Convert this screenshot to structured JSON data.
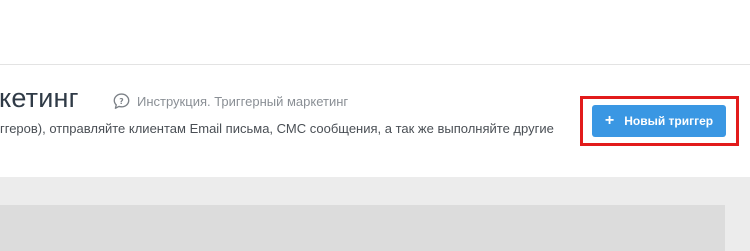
{
  "header": {
    "title": "кетинг",
    "help_link_label": "Инструкция. Триггерный маркетинг",
    "subtitle": "ггеров), отправляйте клиентам Email письма, СМС сообщения, а так же выполняйте другие"
  },
  "actions": {
    "new_trigger_label": "Новый триггер"
  },
  "icons": {
    "help": "speech-bubble-question-icon",
    "add": "plus-icon"
  },
  "colors": {
    "primary_button": "#3a97e3",
    "highlight_border": "#e21b1b"
  }
}
